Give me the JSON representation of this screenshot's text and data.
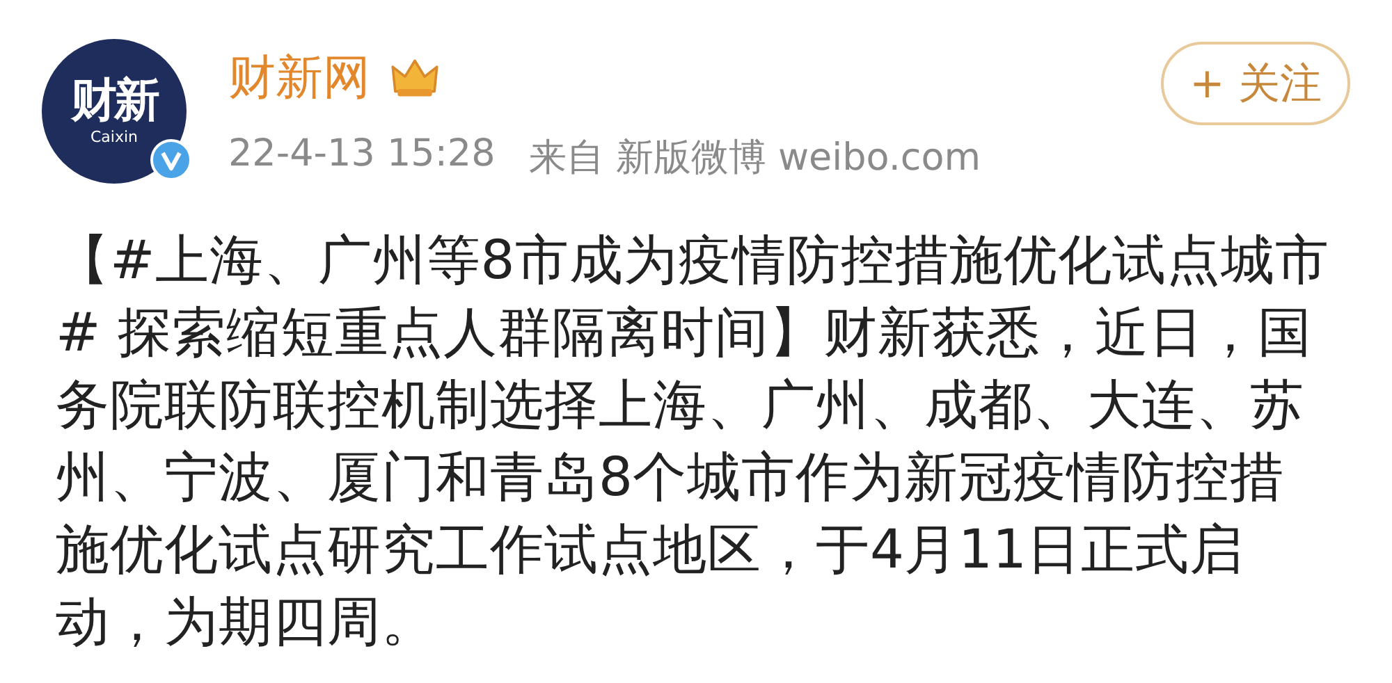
{
  "post": {
    "avatar": {
      "logo_text": "财新",
      "logo_subtext": "Caixin",
      "verified": true
    },
    "author": "财新网",
    "time": "22-4-13 15:28",
    "source": "来自 新版微博 weibo.com",
    "follow_button": "+ 关注",
    "text": "【#上海、广州等8市成为疫情防控措施优化试点城市# 探索缩短重点人群隔离时间】财新获悉，近日，国务院联防联控机制选择上海、广州、成都、大连、苏州、宁波、厦门和青岛8个城市作为新冠疫情防控措施优化试点研究工作试点地区，于4月11日正式启动，为期四周。"
  }
}
